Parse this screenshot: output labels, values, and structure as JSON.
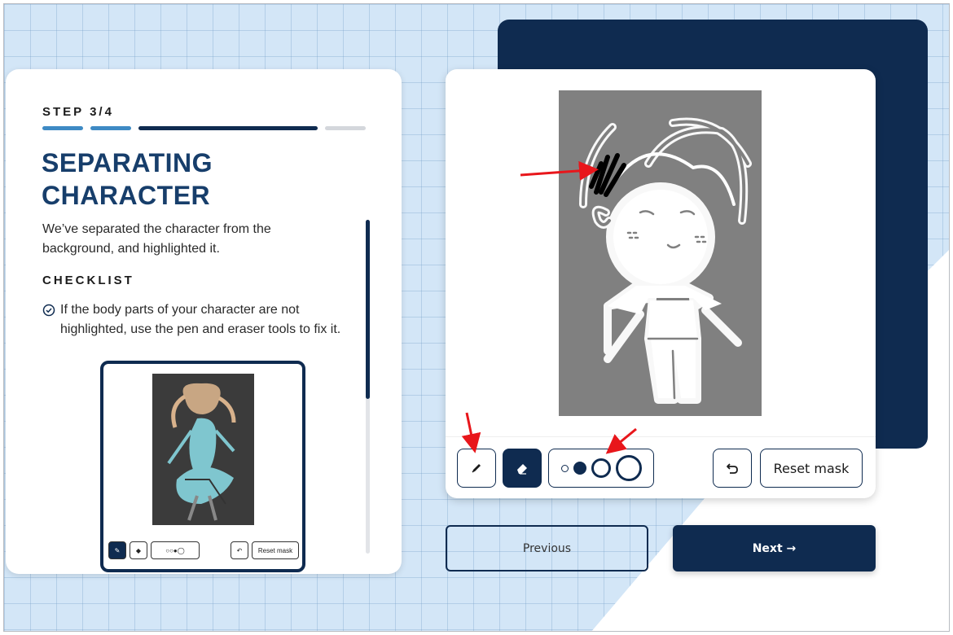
{
  "step": {
    "label": "STEP 3/4",
    "current": 3,
    "total": 4
  },
  "title": "SEPARATING CHARACTER",
  "description": "We’ve separated the character from the background, and highlighted it.",
  "checklist": {
    "heading": "CHECKLIST",
    "items": [
      "If the body parts of your character are not highlighted, use the pen and eraser tools to fix it."
    ]
  },
  "mini_toolbar": {
    "reset_label": "Reset mask"
  },
  "toolbar": {
    "pen_icon": "pencil-icon",
    "eraser_icon": "eraser-icon",
    "brush_sizes": [
      "small",
      "medium",
      "large",
      "x-large"
    ],
    "selected_size": "medium",
    "undo_icon": "undo-icon",
    "reset_label": "Reset mask"
  },
  "navigation": {
    "previous_label": "Previous",
    "next_label": "Next →"
  },
  "colors": {
    "navy": "#0f2b50",
    "title": "#173e6b",
    "progress_done": "#3e8ac4",
    "annotation": "#e8161b"
  }
}
